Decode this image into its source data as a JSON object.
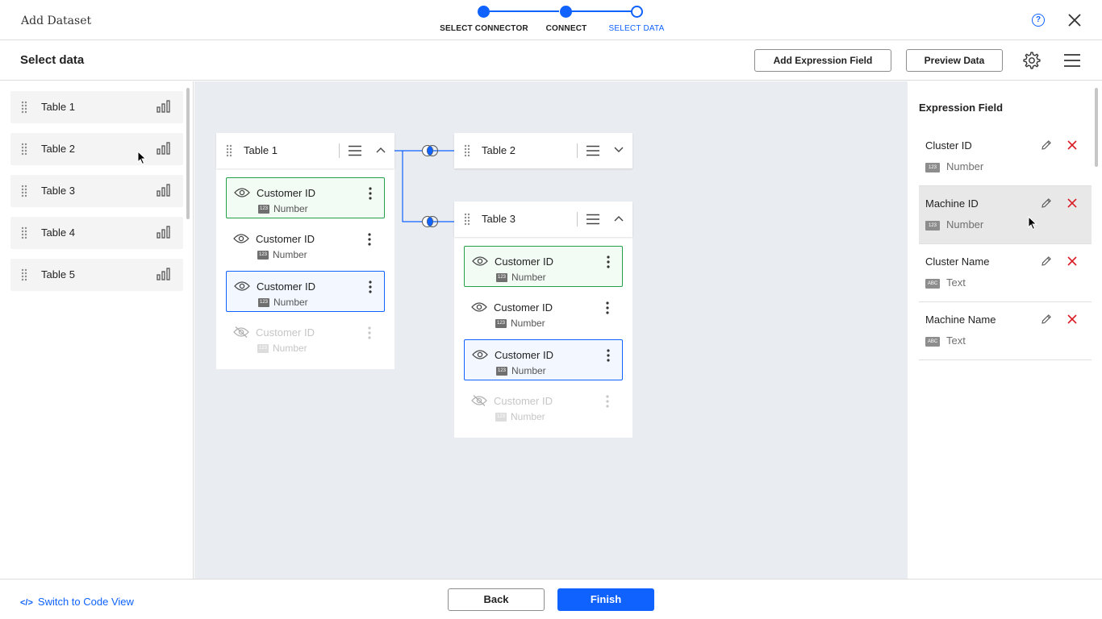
{
  "app": {
    "title": "Add Dataset"
  },
  "stepper": {
    "steps": [
      {
        "label": "SELECT CONNECTOR",
        "state": "done"
      },
      {
        "label": "CONNECT",
        "state": "done"
      },
      {
        "label": "SELECT DATA",
        "state": "current"
      }
    ],
    "accent": "#0f62fe"
  },
  "header": {
    "title": "Select data",
    "add_expression_label": "Add Expression Field",
    "preview_label": "Preview Data",
    "help_label": "?"
  },
  "sidebar": {
    "items": [
      {
        "label": "Table 1"
      },
      {
        "label": "Table 2"
      },
      {
        "label": "Table 3"
      },
      {
        "label": "Table 4"
      },
      {
        "label": "Table 5"
      }
    ]
  },
  "canvas": {
    "tables": [
      {
        "name": "Table 1",
        "expanded": true,
        "fields": [
          {
            "name": "Customer ID",
            "type_icon": "123",
            "type": "Number",
            "state": "green"
          },
          {
            "name": "Customer ID",
            "type_icon": "123",
            "type": "Number",
            "state": "normal"
          },
          {
            "name": "Customer ID",
            "type_icon": "123",
            "type": "Number",
            "state": "blue"
          },
          {
            "name": "Customer ID",
            "type_icon": "123",
            "type": "Number",
            "state": "disabled"
          }
        ]
      },
      {
        "name": "Table 2",
        "expanded": false,
        "fields": []
      },
      {
        "name": "Table 3",
        "expanded": true,
        "fields": [
          {
            "name": "Customer ID",
            "type_icon": "123",
            "type": "Number",
            "state": "green"
          },
          {
            "name": "Customer ID",
            "type_icon": "123",
            "type": "Number",
            "state": "normal"
          },
          {
            "name": "Customer ID",
            "type_icon": "123",
            "type": "Number",
            "state": "blue"
          },
          {
            "name": "Customer ID",
            "type_icon": "123",
            "type": "Number",
            "state": "disabled"
          }
        ]
      }
    ]
  },
  "expression_panel": {
    "title": "Expression Field",
    "items": [
      {
        "name": "Cluster ID",
        "type_icon": "123",
        "type": "Number"
      },
      {
        "name": "Machine ID",
        "type_icon": "123",
        "type": "Number"
      },
      {
        "name": "Cluster Name",
        "type_icon": "ABC",
        "type": "Text"
      },
      {
        "name": "Machine Name",
        "type_icon": "ABC",
        "type": "Text"
      }
    ]
  },
  "footer": {
    "code_icon": "</>",
    "code_view_label": "Switch to Code View",
    "back_label": "Back",
    "finish_label": "Finish"
  },
  "icons": {
    "close": "close-icon",
    "gear": "gear-icon",
    "menu": "hamburger-menu-icon",
    "drag": "drag-handle-icon",
    "bars": "bar-chart-icon",
    "eye": "eye-icon",
    "eye_off": "eye-off-icon",
    "kebab": "kebab-menu-icon",
    "edit": "pencil-icon",
    "delete": "delete-x-icon",
    "join": "join-icon"
  }
}
